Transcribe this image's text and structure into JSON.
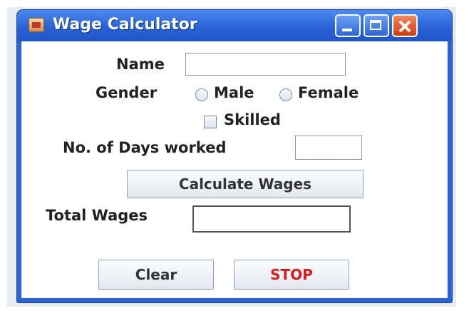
{
  "window": {
    "title": "Wage Calculator"
  },
  "form": {
    "name_label": "Name",
    "name_value": "",
    "gender_label": "Gender",
    "gender_options": [
      "Male",
      "Female"
    ],
    "skilled_label": "Skilled",
    "days_label": "No. of Days worked",
    "days_value": "",
    "total_label": "Total Wages",
    "total_value": ""
  },
  "buttons": {
    "calculate": "Calculate Wages",
    "clear": "Clear",
    "stop": "STOP"
  },
  "colors": {
    "titlebar": "#2a63d6",
    "stop_text": "#d81b1b"
  }
}
